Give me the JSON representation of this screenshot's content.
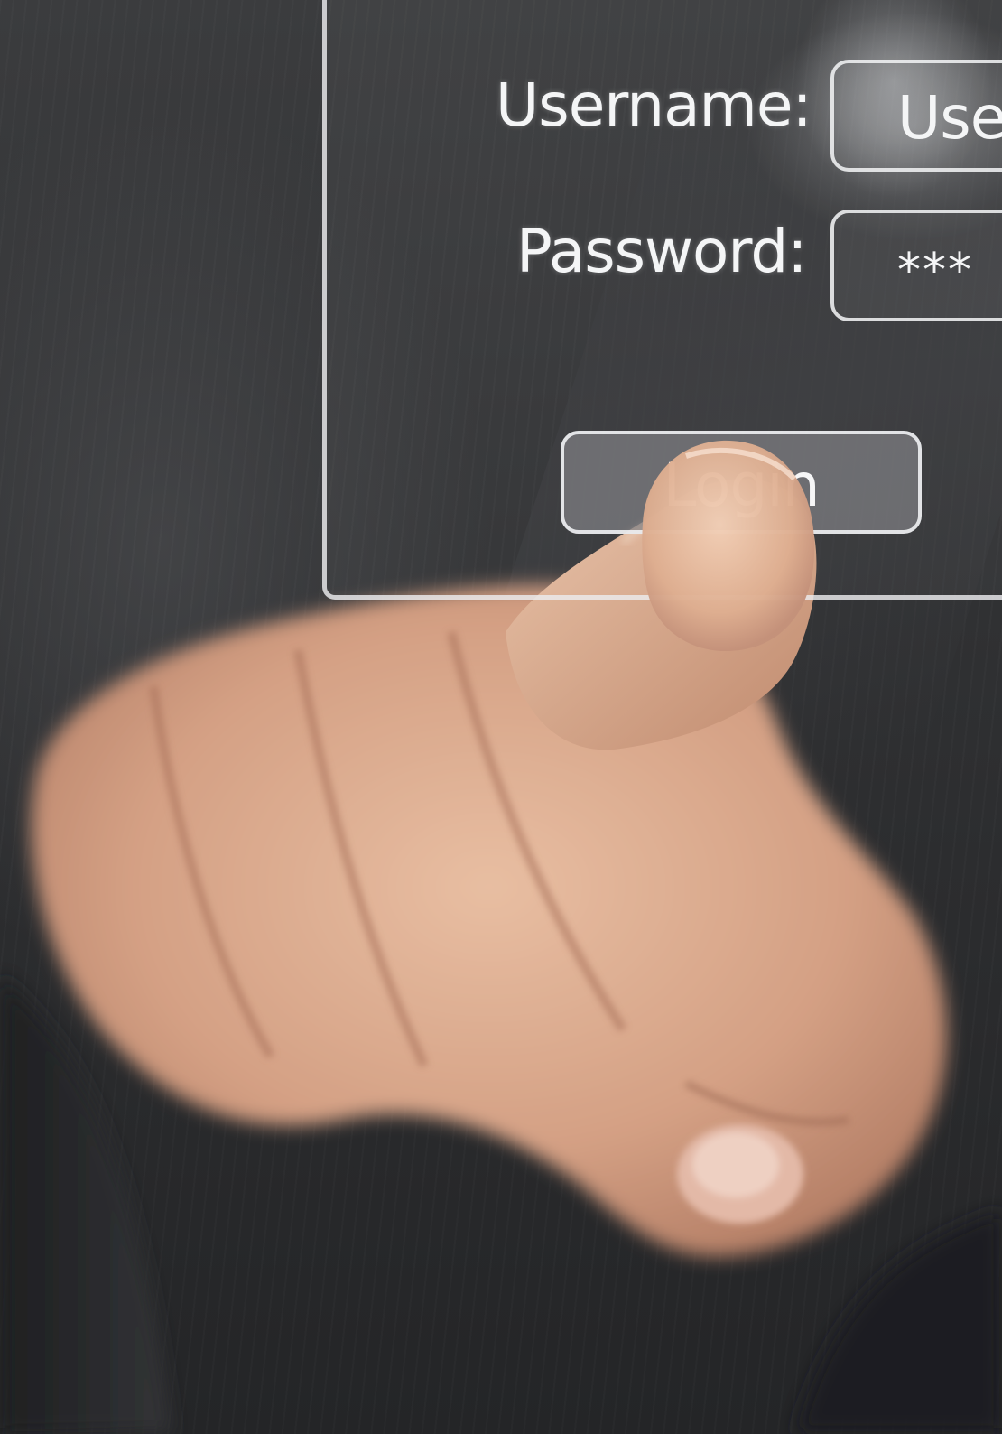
{
  "login_form": {
    "username_label": "Username:",
    "username_value": "Use",
    "password_label": "Password:",
    "password_value": "***",
    "login_button_label": "Login"
  },
  "colors": {
    "background": "#2e2f31",
    "panel_border": "#ebecee",
    "login_button_fill": "#808084",
    "skin": "#d9a98a"
  }
}
